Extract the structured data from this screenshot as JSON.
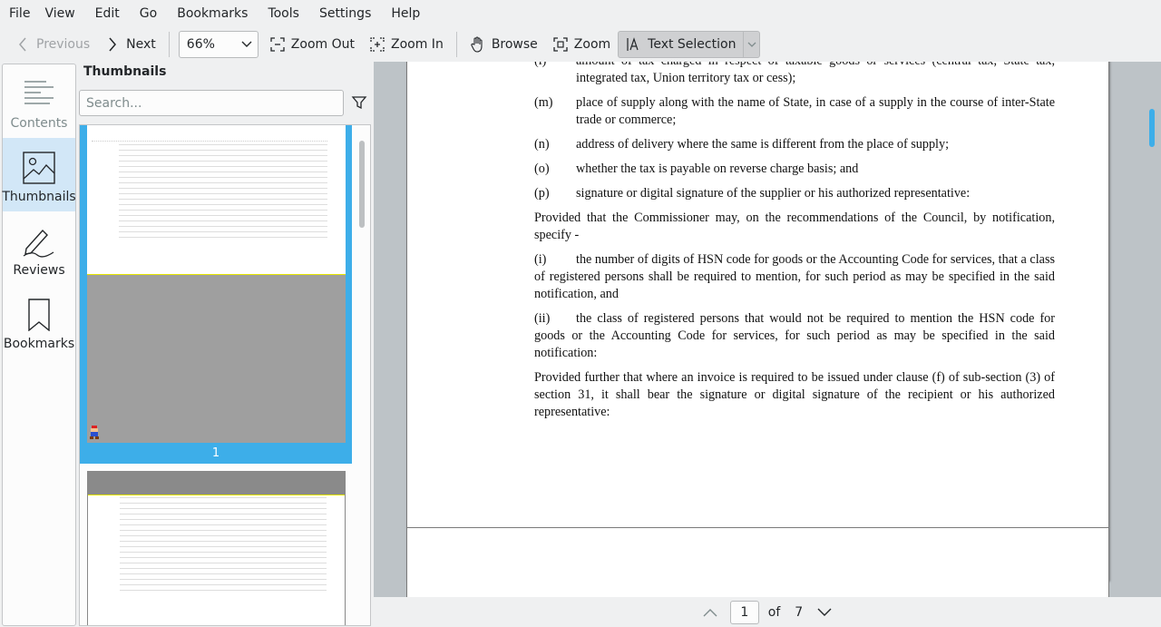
{
  "menu": [
    "File",
    "View",
    "Edit",
    "Go",
    "Bookmarks",
    "Tools",
    "Settings",
    "Help"
  ],
  "toolbar": {
    "previous": "Previous",
    "next": "Next",
    "zoom_value": "66%",
    "zoom_out": "Zoom Out",
    "zoom_in": "Zoom In",
    "browse": "Browse",
    "zoom": "Zoom",
    "text_selection": "Text Selection"
  },
  "sidebar": {
    "tabs": [
      {
        "label": "Contents",
        "icon": "contents-icon"
      },
      {
        "label": "Thumbnails",
        "icon": "thumbnails-icon"
      },
      {
        "label": "Reviews",
        "icon": "reviews-icon"
      },
      {
        "label": "Bookmarks",
        "icon": "bookmarks-icon"
      }
    ]
  },
  "thumbnails": {
    "title": "Thumbnails",
    "search_placeholder": "Search...",
    "page1_label": "1"
  },
  "document": {
    "clause_l": {
      "mark": "(l)",
      "text": "amount of tax charged in respect of taxable goods or services (central tax, State tax, integrated tax, Union territory tax or cess);"
    },
    "clause_m": {
      "mark": "(m)",
      "text": "place of supply along with the name of State, in case of a supply in the course of inter-State trade or commerce;"
    },
    "clause_n": {
      "mark": "(n)",
      "text": "address of delivery where the same is different from the place of supply;"
    },
    "clause_o": {
      "mark": "(o)",
      "text": "whether the tax is payable on reverse charge basis; and"
    },
    "clause_p": {
      "mark": "(p)",
      "text": "signature or digital signature of the supplier or his authorized representative:"
    },
    "proviso1": "Provided that the Commissioner may, on the recommendations of the Council, by notification, specify -",
    "item_i": {
      "mark": "(i)",
      "text": "the number of digits of HSN code for goods or the Accounting Code for services, that a class of registered persons shall be required to mention, for such period as may be specified in the said notification, and"
    },
    "item_ii": {
      "mark": "(ii)",
      "text": "the class of registered persons that would not be required to mention the HSN code for goods or the Accounting Code for services, for such period as may be specified in the said notification:"
    },
    "proviso2": "Provided further that where an invoice is required to be issued under clause (f) of sub-section (3) of section 31, it shall bear the signature or digital signature of the recipient or his authorized representative:",
    "page_number": "1"
  },
  "pagenav": {
    "current": "1",
    "of": "of",
    "total": "7"
  },
  "colors": {
    "accent": "#3daee9",
    "selected_tab": "#d2e7f7"
  }
}
